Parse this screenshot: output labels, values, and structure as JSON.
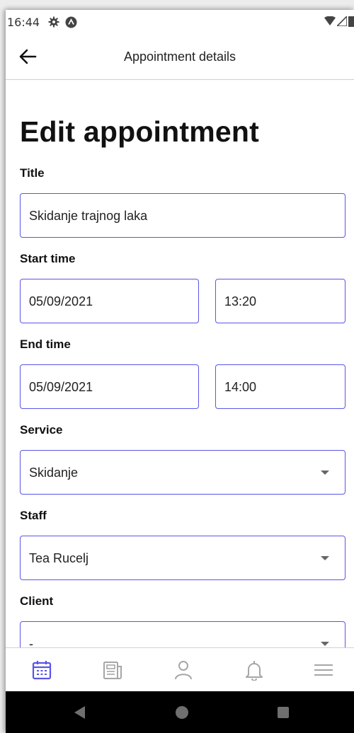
{
  "status_bar": {
    "time": "16:44"
  },
  "app_bar": {
    "title": "Appointment details"
  },
  "page": {
    "heading": "Edit appointment"
  },
  "form": {
    "title": {
      "label": "Title",
      "value": "Skidanje trajnog laka"
    },
    "start_time": {
      "label": "Start time",
      "date": "05/09/2021",
      "time": "13:20"
    },
    "end_time": {
      "label": "End time",
      "date": "05/09/2021",
      "time": "14:00"
    },
    "service": {
      "label": "Service",
      "value": "Skidanje"
    },
    "staff": {
      "label": "Staff",
      "value": "Tea Rucelj"
    },
    "client": {
      "label": "Client",
      "value": "-"
    }
  },
  "bottom_nav": {
    "items": [
      {
        "icon": "calendar-icon",
        "active": true
      },
      {
        "icon": "newspaper-icon",
        "active": false
      },
      {
        "icon": "person-icon",
        "active": false
      },
      {
        "icon": "bell-icon",
        "active": false
      },
      {
        "icon": "menu-icon",
        "active": false
      }
    ]
  },
  "colors": {
    "accent": "#5a55e8",
    "inactive_icon": "#a6a6a6",
    "text": "#222222"
  }
}
